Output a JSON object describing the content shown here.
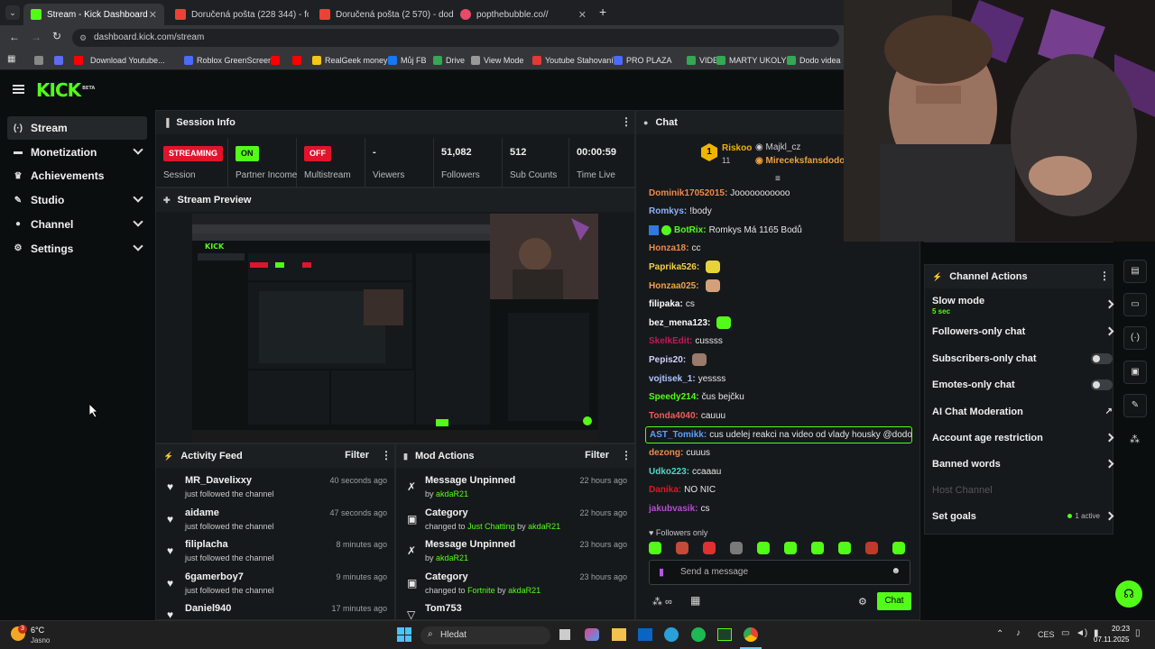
{
  "browser": {
    "tabs": [
      {
        "label": "Stream - Kick Dashboard",
        "icon_color": "#53fc18"
      },
      {
        "label": "Doručená pošta (228 344) - fo",
        "icon_color": "#ea4335"
      },
      {
        "label": "Doručená pošta (2 570) - dodo",
        "icon_color": "#ea4335"
      },
      {
        "label": "popthebubble.co//",
        "icon_color": "#e84a6a"
      }
    ],
    "url": "dashboard.kick.com/stream",
    "bookmarks": [
      {
        "label": "",
        "color": "#888"
      },
      {
        "label": "",
        "color": "#5d6cf0"
      },
      {
        "label": "",
        "color": "#ff0000"
      },
      {
        "label": "Download Youtube...",
        "color": ""
      },
      {
        "label": "Roblox GreenScreen",
        "color": "#4a6cf7"
      },
      {
        "label": "",
        "color": "#ff0000"
      },
      {
        "label": "",
        "color": "#ff0000"
      },
      {
        "label": "RealGeek money",
        "color": "#f5c518"
      },
      {
        "label": "Můj FB",
        "color": "#1877f2"
      },
      {
        "label": "Drive",
        "color": "#34a853"
      },
      {
        "label": "View Mode",
        "color": "#999"
      },
      {
        "label": "Youtube Stahovaní",
        "color": "#e53935"
      },
      {
        "label": "PRO PLAZA",
        "color": "#4a6cf7"
      },
      {
        "label": "VIDEA",
        "color": "#34a853"
      },
      {
        "label": "MARTY UKOLY",
        "color": "#34a853"
      },
      {
        "label": "Dodo videa",
        "color": "#34a853"
      }
    ]
  },
  "kick": {
    "logo": "KICK",
    "logo_beta": "BETA",
    "accent": "#53fc18"
  },
  "sidebar": {
    "items": [
      {
        "label": "Stream",
        "icon": "broadcast-icon",
        "glyph": "(·)",
        "chevron": false
      },
      {
        "label": "Monetization",
        "icon": "wallet-icon",
        "glyph": "▬",
        "chevron": true
      },
      {
        "label": "Achievements",
        "icon": "trophy-icon",
        "glyph": "♛",
        "chevron": false
      },
      {
        "label": "Studio",
        "icon": "pen-icon",
        "glyph": "✎",
        "chevron": true
      },
      {
        "label": "Channel",
        "icon": "user-icon",
        "glyph": "●",
        "chevron": true
      },
      {
        "label": "Settings",
        "icon": "gear-icon",
        "glyph": "⚙",
        "chevron": true
      }
    ]
  },
  "session": {
    "title": "Session Info",
    "stats": [
      {
        "badge": "STREAMING",
        "label": "Session",
        "badge_bg": "#e0142a",
        "badge_fg": "#ffffff"
      },
      {
        "badge": "ON",
        "label": "Partner Income",
        "badge_bg": "#53fc18",
        "badge_fg": "#0b0e0f"
      },
      {
        "badge": "OFF",
        "label": "Multistream",
        "badge_bg": "#e0142a",
        "badge_fg": "#ffffff"
      },
      {
        "value": "-",
        "label": "Viewers"
      },
      {
        "value": "51,082",
        "label": "Followers"
      },
      {
        "value": "512",
        "label": "Sub Counts"
      },
      {
        "value": "00:00:59",
        "label": "Time Live"
      }
    ]
  },
  "preview": {
    "title": "Stream Preview"
  },
  "activity": {
    "title": "Activity Feed",
    "filter": "Filter",
    "rows": [
      {
        "name": "MR_Davelixxy",
        "sub": "just followed the channel",
        "time": "40 seconds ago"
      },
      {
        "name": "aidame",
        "sub": "just followed the channel",
        "time": "47 seconds ago"
      },
      {
        "name": "filiplacha",
        "sub": "just followed the channel",
        "time": "8 minutes ago"
      },
      {
        "name": "6gamerboy7",
        "sub": "just followed the channel",
        "time": "9 minutes ago"
      },
      {
        "name": "Daniel940",
        "sub": "",
        "time": "17 minutes ago"
      }
    ]
  },
  "mod": {
    "title": "Mod Actions",
    "filter": "Filter",
    "rows": [
      {
        "name": "Message Unpinned",
        "pre": "by",
        "link": "akdaR21",
        "time": "22 hours ago",
        "icon": "unpin-icon",
        "glyph": "✗"
      },
      {
        "name": "Category",
        "pre": "changed to",
        "link": "Just Chatting",
        "mid": "by",
        "link2": "akdaR21",
        "time": "22 hours ago",
        "icon": "category-icon",
        "glyph": "▣"
      },
      {
        "name": "Message Unpinned",
        "pre": "by",
        "link": "akdaR21",
        "time": "23 hours ago",
        "icon": "unpin-icon",
        "glyph": "✗"
      },
      {
        "name": "Category",
        "pre": "changed to",
        "link": "Fortnite",
        "mid": "by",
        "link2": "akdaR21",
        "time": "23 hours ago",
        "icon": "category-icon",
        "glyph": "▣"
      },
      {
        "name": "Tom753",
        "pre": "",
        "link": "",
        "time": "",
        "icon": "chevron-icon",
        "glyph": "▽"
      }
    ]
  },
  "chat": {
    "title": "Chat",
    "top": {
      "rank": "1",
      "name": "Riskoo",
      "count": "11",
      "second": "Majkl_cz",
      "third": "Mireceksfansdodo"
    },
    "messages": [
      {
        "user": "Dominik17052015",
        "color": "#f08a4b",
        "text": "Jooooooooooo"
      },
      {
        "user": "Romkys",
        "color": "#8fb2ff",
        "text": "!body"
      },
      {
        "user": "BotRix",
        "color": "#53fc18",
        "text": "Romkys Má 1165 Bodů",
        "badges": true
      },
      {
        "user": "Honza18",
        "color": "#f08a4b",
        "text": "cc"
      },
      {
        "user": "Paprika526",
        "color": "#f5d142",
        "text": "",
        "emote": "#e8d23a"
      },
      {
        "user": "Honzaa025",
        "color": "#f5a142",
        "text": "",
        "emote": "#d4a07a"
      },
      {
        "user": "filipaka",
        "color": "#ffffff",
        "text": "cs"
      },
      {
        "user": "bez_mena123",
        "color": "#ffffff",
        "text": "",
        "emote": "#53fc18"
      },
      {
        "user": "SkelkEdit",
        "color": "#c2185b",
        "text": "cussss"
      },
      {
        "user": "Pepis20",
        "color": "#d0d0ff",
        "text": "",
        "emote": "#9a7a6a"
      },
      {
        "user": "vojtisek_1",
        "color": "#b0c4ff",
        "text": "yessss"
      },
      {
        "user": "Speedy214",
        "color": "#53fc18",
        "text": "čus bejčku"
      },
      {
        "user": "Tonda4040",
        "color": "#f05a5a",
        "text": "cauuu"
      },
      {
        "user": "AST_Tomikk",
        "color": "#5aa0ff",
        "text": "cus udelej reakci na video od vlady housky @dodo",
        "highlight": true
      },
      {
        "user": "dezong",
        "color": "#f08a4b",
        "text": "cuuus"
      },
      {
        "user": "Udko223",
        "color": "#4fd6c8",
        "text": "ccaaau"
      },
      {
        "user": "Danika",
        "color": "#e0142a",
        "text": "NO NIC"
      },
      {
        "user": "jakubvasik",
        "color": "#b84ad6",
        "text": "cs"
      }
    ],
    "followers_only": "Followers only",
    "placeholder": "Send a message",
    "send": "Chat",
    "emote_colors": [
      "#53fc18",
      "#c44a3a",
      "#e03030",
      "#7a7a7a",
      "#53fc18",
      "#53fc18",
      "#53fc18",
      "#53fc18",
      "#c0392b",
      "#53fc18"
    ]
  },
  "channel_actions": {
    "title": "Channel Actions",
    "rows": [
      {
        "label": "Slow mode",
        "sub": "5 sec",
        "kind": "caret"
      },
      {
        "label": "Followers-only chat",
        "kind": "caret"
      },
      {
        "label": "Subscribers-only chat",
        "kind": "toggle"
      },
      {
        "label": "Emotes-only chat",
        "kind": "toggle"
      },
      {
        "label": "AI Chat Moderation",
        "kind": "external"
      },
      {
        "label": "Account age restriction",
        "kind": "caret"
      },
      {
        "label": "Banned words",
        "kind": "caret"
      },
      {
        "label": "Host Channel",
        "kind": "disabled"
      },
      {
        "label": "Set goals",
        "kind": "caret",
        "status": "1 active"
      }
    ]
  },
  "taskbar": {
    "weather_temp": "6°C",
    "weather_desc": "Jasno",
    "search": "Hledat",
    "lang": "CES",
    "time": "20:23",
    "date": "07.11.2025",
    "notif": "3"
  }
}
